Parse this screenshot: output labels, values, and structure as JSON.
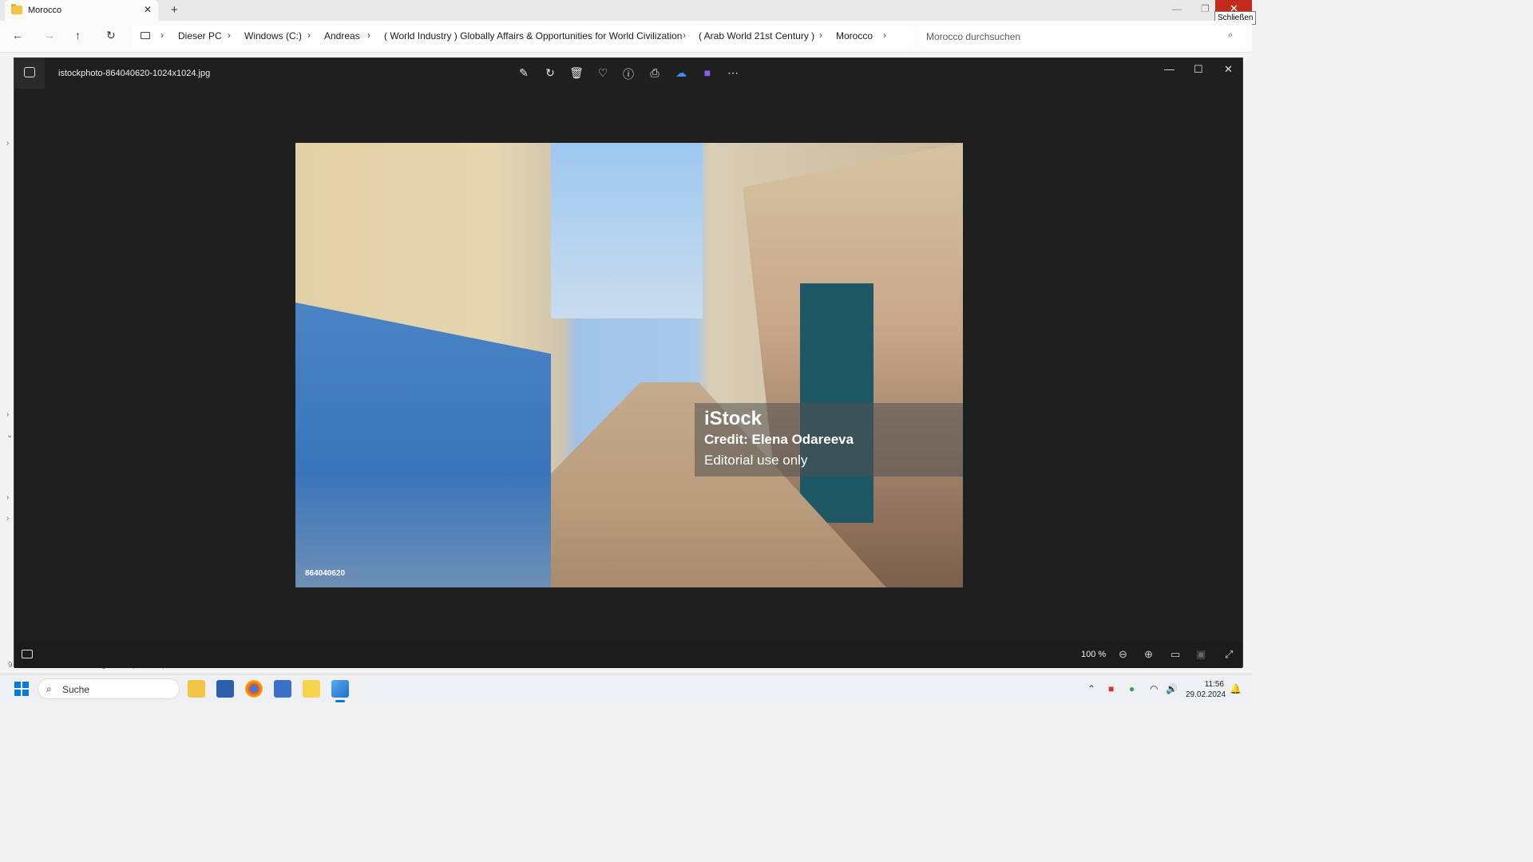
{
  "explorer": {
    "tab_title": "Morocco",
    "new_tab": "+",
    "tooltip": "Schließen",
    "breadcrumb": [
      "Dieser PC",
      "Windows (C:)",
      "Andreas",
      "( World Industry ) Globally Affairs & Opportunities for World Civilization",
      "( Arab World 21st Century )",
      "Morocco"
    ],
    "search_placeholder": "Morocco durchsuchen",
    "status_remnant": "9 Elemente  1 Element ausgewählt (84,9 KB)"
  },
  "photos": {
    "filename": "istockphoto-864040620-1024x1024.jpg",
    "toolbar_icons": [
      "edit-icon",
      "rotate-icon",
      "delete-icon",
      "favorite-icon",
      "info-icon",
      "print-icon",
      "onedrive-icon",
      "clipchamp-icon",
      "more-icon"
    ],
    "zoom": "100 %",
    "image": {
      "watermark_logo": "iStock",
      "credit": "Credit: Elena Odareeva",
      "editorial": "Editorial use only",
      "image_id": "864040620"
    }
  },
  "taskbar": {
    "search_label": "Suche",
    "time": "11:56",
    "date": "29.02.2024",
    "apps": [
      "file-explorer",
      "microsoft-store",
      "chrome",
      "notepad",
      "sticky-notes",
      "photos"
    ]
  },
  "colors": {
    "accent": "#0a7ad6",
    "close_red": "#c42b1c",
    "viewer_bg": "#1f1f1f"
  }
}
